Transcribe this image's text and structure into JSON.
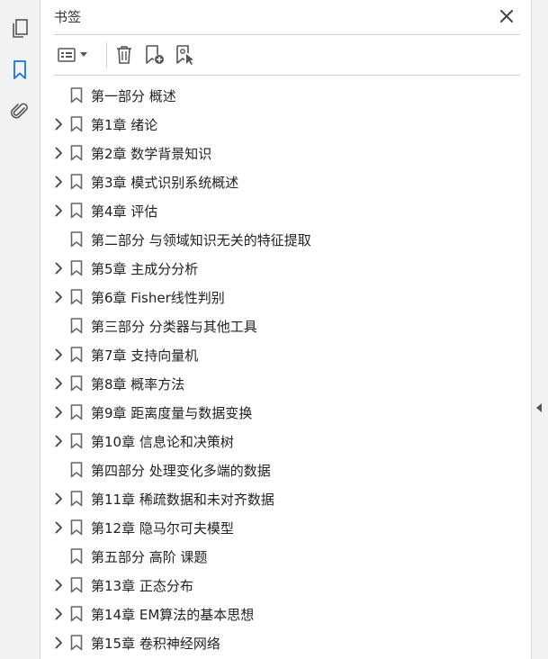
{
  "panel": {
    "title": "书签"
  },
  "rail": {
    "icons": [
      "pages-icon",
      "bookmark-icon",
      "attachment-icon"
    ]
  },
  "toolbar": {
    "buttons": [
      "options-menu",
      "delete-bookmark",
      "new-bookmark",
      "new-bookmark-from-structure"
    ]
  },
  "bookmarks": [
    {
      "label": "第一部分 概述",
      "expandable": false
    },
    {
      "label": "第1章 绪论",
      "expandable": true
    },
    {
      "label": "第2章 数学背景知识",
      "expandable": true
    },
    {
      "label": "第3章 模式识别系统概述",
      "expandable": true
    },
    {
      "label": "第4章 评估",
      "expandable": true
    },
    {
      "label": "第二部分 与领域知识无关的特征提取",
      "expandable": false
    },
    {
      "label": "第5章 主成分分析",
      "expandable": true
    },
    {
      "label": "第6章 Fisher线性判别",
      "expandable": true
    },
    {
      "label": "第三部分 分类器与其他工具",
      "expandable": false
    },
    {
      "label": "第7章 支持向量机",
      "expandable": true
    },
    {
      "label": "第8章 概率方法",
      "expandable": true
    },
    {
      "label": "第9章 距离度量与数据变换",
      "expandable": true
    },
    {
      "label": "第10章 信息论和决策树",
      "expandable": true
    },
    {
      "label": "第四部分 处理变化多端的数据",
      "expandable": false
    },
    {
      "label": "第11章 稀疏数据和未对齐数据",
      "expandable": true
    },
    {
      "label": "第12章 隐马尔可夫模型",
      "expandable": true
    },
    {
      "label": "第五部分 高阶 课题",
      "expandable": false
    },
    {
      "label": "第13章 正态分布",
      "expandable": true
    },
    {
      "label": "第14章 EM算法的基本思想",
      "expandable": true
    },
    {
      "label": "第15章 卷积神经网络",
      "expandable": true
    }
  ],
  "colors": {
    "accent": "#1473e6",
    "icon": "#555555"
  }
}
